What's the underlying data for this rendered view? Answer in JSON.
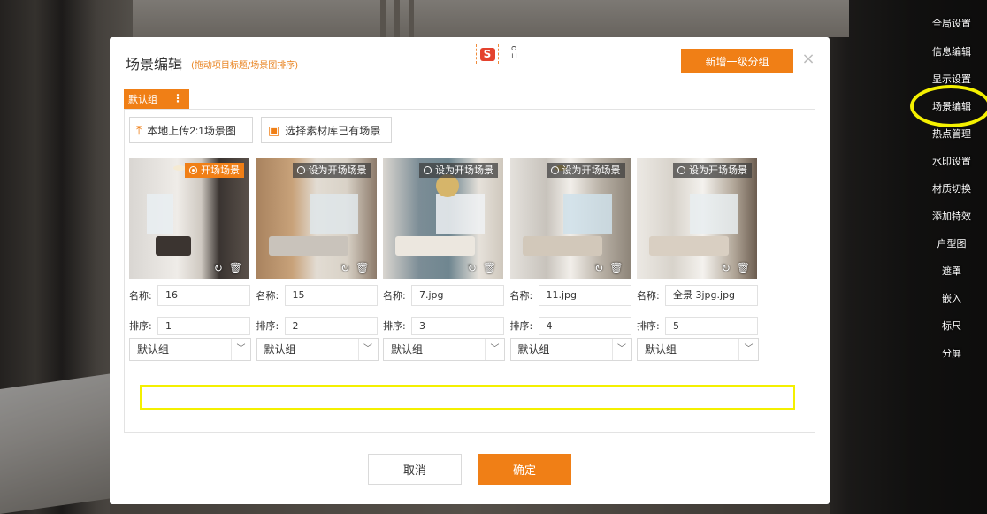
{
  "sidebar": {
    "items": [
      {
        "label": "全局设置"
      },
      {
        "label": "信息编辑"
      },
      {
        "label": "显示设置"
      },
      {
        "label": "场景编辑"
      },
      {
        "label": "热点管理"
      },
      {
        "label": "水印设置"
      },
      {
        "label": "材质切换"
      },
      {
        "label": "添加特效"
      },
      {
        "label": "户型图"
      },
      {
        "label": "遮罩"
      },
      {
        "label": "嵌入"
      },
      {
        "label": "标尺"
      },
      {
        "label": "分屏"
      }
    ],
    "highlighted": "场景编辑"
  },
  "modal": {
    "title": "场景编辑",
    "subtitle": "(拖动项目标题/场景图排序)",
    "logo_letter": "S",
    "add_group_label": "新增一级分组",
    "close_symbol": "×",
    "group_tab_label": "默认组",
    "group_tab_more": "⋮",
    "upload_label": "本地上传2:1场景图",
    "library_label": "选择素材库已有场景",
    "name_label": "名称:",
    "sort_label": "排序:",
    "cancel_label": "取消",
    "confirm_label": "确定"
  },
  "scenes": [
    {
      "badge": "开场场景",
      "active": true,
      "name": "16",
      "sort": "1",
      "group": "默认组"
    },
    {
      "badge": "设为开场场景",
      "active": false,
      "name": "15",
      "sort": "2",
      "group": "默认组"
    },
    {
      "badge": "设为开场场景",
      "active": false,
      "name": "7.jpg",
      "sort": "3",
      "group": "默认组"
    },
    {
      "badge": "设为开场场景",
      "active": false,
      "name": "11.jpg",
      "sort": "4",
      "group": "默认组"
    },
    {
      "badge": "设为开场场景",
      "active": false,
      "name": "全景 3jpg.jpg",
      "sort": "5",
      "group": "默认组"
    }
  ],
  "colors": {
    "accent": "#f07f16",
    "highlight": "#f4f000"
  }
}
